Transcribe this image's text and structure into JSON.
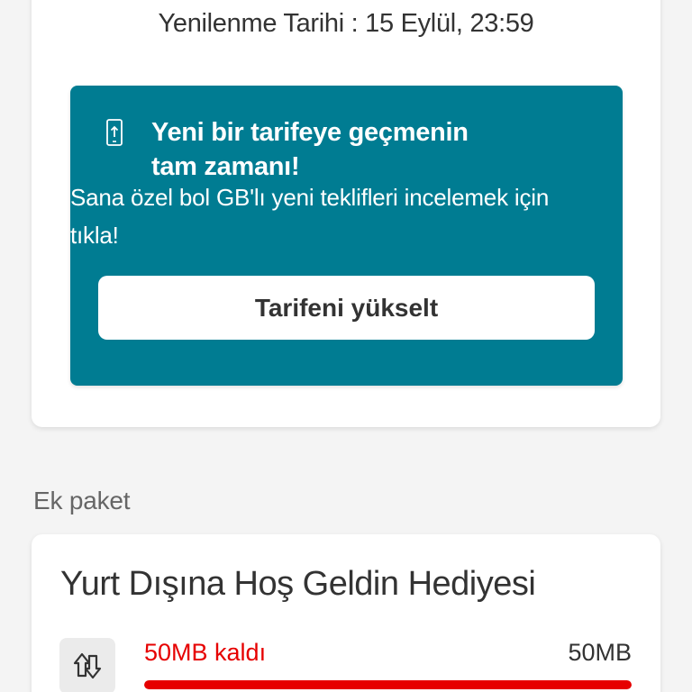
{
  "renewal": {
    "text": "Yenilenme Tarihi : 15 Eylül, 23:59"
  },
  "promo": {
    "icon": "phone-upgrade-icon",
    "title_line1": "Yeni bir tarifeye geçmenin",
    "title_line2": "tam zamanı!",
    "description": "Sana özel bol GB'lı yeni teklifleri incelemek için tıkla!",
    "button_label": "Tarifeni yükselt",
    "background_color": "#007c92"
  },
  "addon_section": {
    "label": "Ek paket",
    "package": {
      "icon": "data-transfer-icon",
      "title": "Yurt Dışına Hoş Geldin Hediyesi",
      "remaining_text": "50MB kaldı",
      "total_text": "50MB",
      "remaining_fraction": 1.0,
      "accent_color": "#e60000"
    }
  }
}
